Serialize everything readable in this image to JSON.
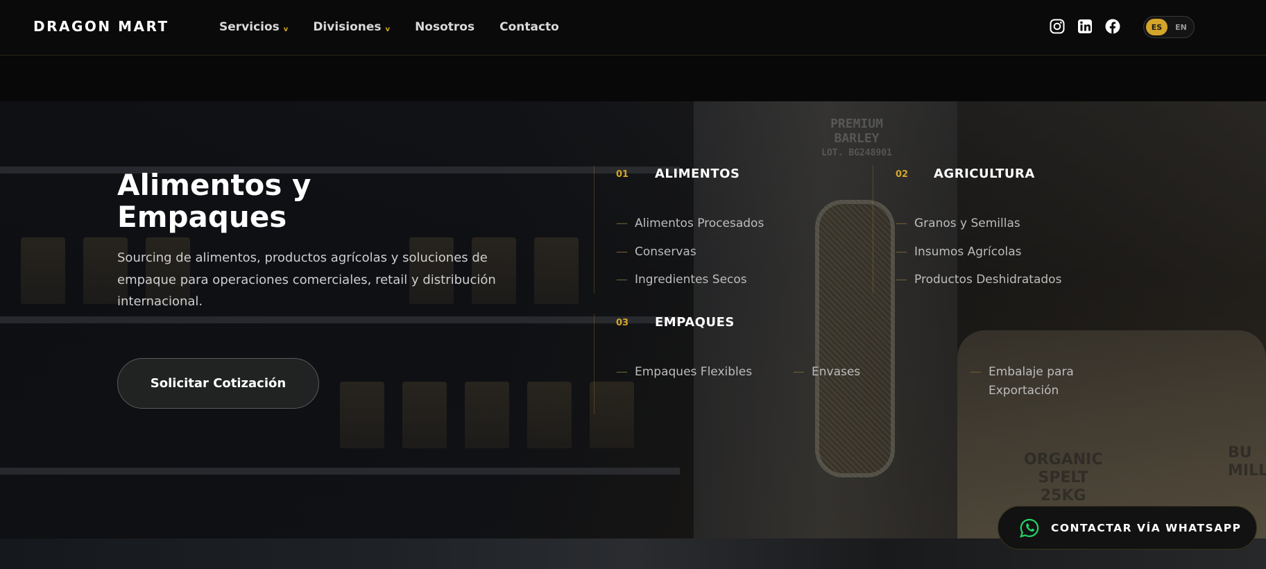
{
  "brand": {
    "logo": "DRAGON MART"
  },
  "nav": {
    "items": [
      {
        "label": "Servicios",
        "dropdown": true
      },
      {
        "label": "Divisiones",
        "dropdown": true
      },
      {
        "label": "Nosotros",
        "dropdown": false
      },
      {
        "label": "Contacto",
        "dropdown": false
      }
    ],
    "chevron": "v",
    "social": [
      "instagram-icon",
      "linkedin-icon",
      "facebook-icon"
    ],
    "language": {
      "options": [
        "ES",
        "EN"
      ],
      "selected": "ES"
    }
  },
  "hero": {
    "title_line1": "Alimentos y",
    "title_line2": "Empaques",
    "description": "Sourcing de alimentos, productos agrícolas y soluciones de empaque para operaciones comerciales, retail y distribución internacional.",
    "cta_label": "Solicitar Cotización",
    "background_text": {
      "tank_label": [
        "PREMIUM",
        "BARLEY",
        "LOT. BG248901"
      ],
      "sack_left": [
        "ORGANIC",
        "SPELT",
        "25KG"
      ],
      "sack_right": [
        "BU",
        "MILLE"
      ]
    }
  },
  "categories": [
    {
      "number": "01",
      "title": "ALIMENTOS",
      "items": [
        "Alimentos Procesados",
        "Conservas",
        "Ingredientes Secos"
      ]
    },
    {
      "number": "02",
      "title": "AGRICULTURA",
      "items": [
        "Granos y Semillas",
        "Insumos Agrícolas",
        "Productos Deshidratados"
      ]
    },
    {
      "number": "03",
      "title": "EMPAQUES",
      "items": [
        "Empaques Flexibles",
        "Envases",
        "Embalaje para Exportación"
      ]
    }
  ],
  "whatsapp": {
    "label": "CONTACTAR VÍA WHATSAPP",
    "icon": "whatsapp-icon"
  },
  "colors": {
    "accent": "#d4a52a",
    "background": "#080808",
    "whatsapp_green": "#25d366"
  }
}
